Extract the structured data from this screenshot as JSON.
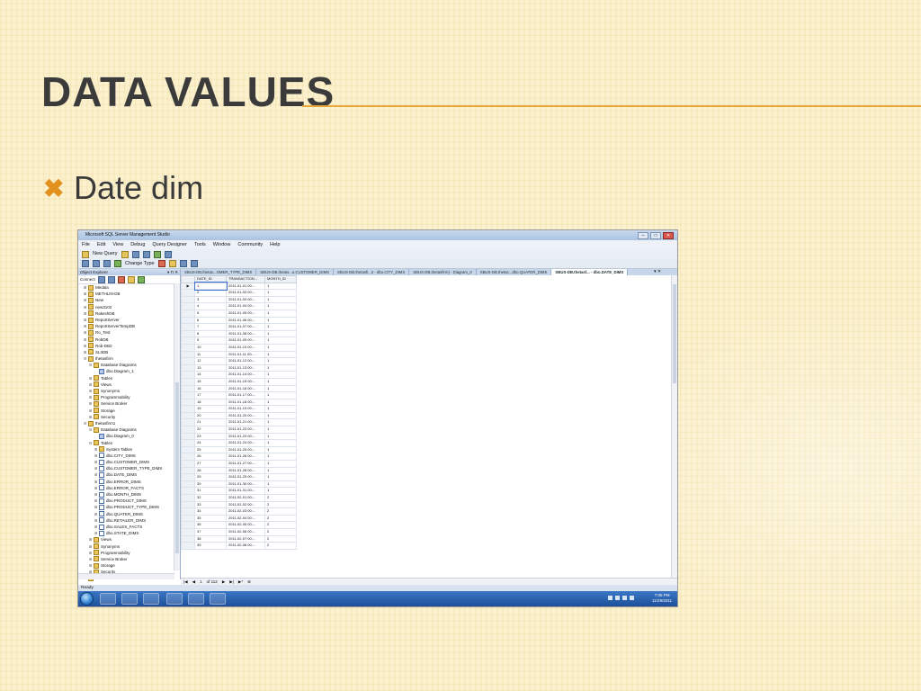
{
  "slide": {
    "title": "Data Values",
    "bullet_mark": "✖",
    "bullet": "Date dim"
  },
  "ssms": {
    "window_title": "Microsoft SQL Server Management Studio",
    "window_controls": [
      "–",
      "□",
      "✕"
    ],
    "menu": [
      "File",
      "Edit",
      "View",
      "Debug",
      "Query Designer",
      "Tools",
      "Window",
      "Community",
      "Help"
    ],
    "toolbar1": {
      "new_query": "New Query"
    },
    "toolbar2": {
      "change_type": "Change Type"
    },
    "explorer": {
      "title": "Object Explorer",
      "header_controls": "▾ ⊓ ✕",
      "connect": "Connect",
      "tree": [
        {
          "indent": 1,
          "pm": "⊞",
          "icon": "folder",
          "label": "Medala"
        },
        {
          "indent": 1,
          "pm": "⊞",
          "icon": "folder",
          "label": "METHLIN-DB"
        },
        {
          "indent": 1,
          "pm": "⊞",
          "icon": "folder",
          "label": "New"
        },
        {
          "indent": 1,
          "pm": "⊞",
          "icon": "folder",
          "label": "new3102"
        },
        {
          "indent": 1,
          "pm": "⊞",
          "icon": "folder",
          "label": "RakeshDB"
        },
        {
          "indent": 1,
          "pm": "⊞",
          "icon": "folder",
          "label": "ReportServer"
        },
        {
          "indent": 1,
          "pm": "⊞",
          "icon": "folder",
          "label": "ReportServerTempDB"
        },
        {
          "indent": 1,
          "pm": "⊞",
          "icon": "folder",
          "label": "Ro_Test"
        },
        {
          "indent": 1,
          "pm": "⊞",
          "icon": "folder",
          "label": "RobDB"
        },
        {
          "indent": 1,
          "pm": "⊞",
          "icon": "folder",
          "label": "Rob-DB2"
        },
        {
          "indent": 1,
          "pm": "⊞",
          "icon": "folder",
          "label": "SLIIDB"
        },
        {
          "indent": 1,
          "pm": "⊟",
          "icon": "folder",
          "label": "thetasfirm"
        },
        {
          "indent": 2,
          "pm": "⊟",
          "icon": "folder",
          "label": "Database Diagrams"
        },
        {
          "indent": 3,
          "pm": "",
          "icon": "diagram",
          "label": "dbo.Diagram_1"
        },
        {
          "indent": 2,
          "pm": "⊞",
          "icon": "folder",
          "label": "Tables"
        },
        {
          "indent": 2,
          "pm": "⊞",
          "icon": "folder",
          "label": "Views"
        },
        {
          "indent": 2,
          "pm": "⊞",
          "icon": "folder",
          "label": "Synonyms"
        },
        {
          "indent": 2,
          "pm": "⊞",
          "icon": "folder",
          "label": "Programmability"
        },
        {
          "indent": 2,
          "pm": "⊞",
          "icon": "folder",
          "label": "Service Broker"
        },
        {
          "indent": 2,
          "pm": "⊞",
          "icon": "folder",
          "label": "Storage"
        },
        {
          "indent": 2,
          "pm": "⊞",
          "icon": "folder",
          "label": "Security"
        },
        {
          "indent": 1,
          "pm": "⊟",
          "icon": "folder",
          "label": "thetasfirm1"
        },
        {
          "indent": 2,
          "pm": "⊟",
          "icon": "folder",
          "label": "Database Diagrams"
        },
        {
          "indent": 3,
          "pm": "",
          "icon": "diagram",
          "label": "dbo.Diagram_0"
        },
        {
          "indent": 2,
          "pm": "⊟",
          "icon": "folder",
          "label": "Tables"
        },
        {
          "indent": 3,
          "pm": "⊞",
          "icon": "folder",
          "label": "System Tables"
        },
        {
          "indent": 3,
          "pm": "⊞",
          "icon": "table",
          "label": "dbo.CITY_DIMS"
        },
        {
          "indent": 3,
          "pm": "⊞",
          "icon": "table",
          "label": "dbo.CUSTOMER_DIMS"
        },
        {
          "indent": 3,
          "pm": "⊞",
          "icon": "table",
          "label": "dbo.CUSTOMER_TYPE_DIMS"
        },
        {
          "indent": 3,
          "pm": "⊞",
          "icon": "table",
          "label": "dbo.DATE_DIMS"
        },
        {
          "indent": 3,
          "pm": "⊞",
          "icon": "table",
          "label": "dbo.ERROR_DIMS"
        },
        {
          "indent": 3,
          "pm": "⊞",
          "icon": "table",
          "label": "dbo.ERROR_FACTS"
        },
        {
          "indent": 3,
          "pm": "⊞",
          "icon": "table",
          "label": "dbo.MONTH_DIMS"
        },
        {
          "indent": 3,
          "pm": "⊞",
          "icon": "table",
          "label": "dbo.PRODUCT_DIMS"
        },
        {
          "indent": 3,
          "pm": "⊞",
          "icon": "table",
          "label": "dbo.PRODUCT_TYPE_DIMS"
        },
        {
          "indent": 3,
          "pm": "⊞",
          "icon": "table",
          "label": "dbo.QUATER_DIMS"
        },
        {
          "indent": 3,
          "pm": "⊞",
          "icon": "table",
          "label": "dbo.RETAILER_DIMS"
        },
        {
          "indent": 3,
          "pm": "⊞",
          "icon": "table",
          "label": "dbo.SALES_FACTS"
        },
        {
          "indent": 3,
          "pm": "⊞",
          "icon": "table",
          "label": "dbo.STATE_DIMS"
        },
        {
          "indent": 2,
          "pm": "⊞",
          "icon": "folder",
          "label": "Views"
        },
        {
          "indent": 2,
          "pm": "⊞",
          "icon": "folder",
          "label": "Synonyms"
        },
        {
          "indent": 2,
          "pm": "⊞",
          "icon": "folder",
          "label": "Programmability"
        },
        {
          "indent": 2,
          "pm": "⊞",
          "icon": "folder",
          "label": "Service Broker"
        },
        {
          "indent": 2,
          "pm": "⊞",
          "icon": "folder",
          "label": "Storage"
        },
        {
          "indent": 2,
          "pm": "⊞",
          "icon": "folder",
          "label": "Security"
        },
        {
          "indent": 1,
          "pm": "⊞",
          "icon": "folder",
          "label": "uthemz0992"
        }
      ]
    },
    "tabs": [
      {
        "label": "SBUS-DB.thetas...OMER_TYPE_DIMS",
        "active": false
      },
      {
        "label": "SBUS-DB.thetas...o.CUSTOMER_DIMS",
        "active": false
      },
      {
        "label": "SBUS-DB.thetasfi...2 - dbo.CITY_DIMS",
        "active": false
      },
      {
        "label": "SBUS-DB.thetasfirm) - Diagram_0",
        "active": false
      },
      {
        "label": "SBUS-DB.thetas...dbo.QUATER_DIMS",
        "active": false
      },
      {
        "label": "SBUS-DB.thetasf... - dbo.DATE_DIMS",
        "active": true
      }
    ],
    "tab_controls": "▾ ✕",
    "grid": {
      "columns": [
        "DATE_ID",
        "TRANSACTION...",
        "MONTH_ID"
      ],
      "rows": [
        [
          "1",
          "2011-01-01 00:...",
          "1"
        ],
        [
          "2",
          "2011-01-02 00:...",
          "1"
        ],
        [
          "3",
          "2011-01-03 00:...",
          "1"
        ],
        [
          "4",
          "2011-01-04 00:...",
          "1"
        ],
        [
          "5",
          "2011-01-05 00:...",
          "1"
        ],
        [
          "6",
          "2011-01-06 00:...",
          "1"
        ],
        [
          "7",
          "2011-01-07 00:...",
          "1"
        ],
        [
          "8",
          "2011-01-08 00:...",
          "1"
        ],
        [
          "9",
          "2011-01-09 00:...",
          "1"
        ],
        [
          "10",
          "2011-01-10 00:...",
          "1"
        ],
        [
          "11",
          "2011-01-11 00:...",
          "1"
        ],
        [
          "12",
          "2011-01-12 00:...",
          "1"
        ],
        [
          "13",
          "2011-01-13 00:...",
          "1"
        ],
        [
          "14",
          "2011-01-14 00:...",
          "1"
        ],
        [
          "15",
          "2011-01-15 00:...",
          "1"
        ],
        [
          "16",
          "2011-01-16 00:...",
          "1"
        ],
        [
          "17",
          "2011-01-17 00:...",
          "1"
        ],
        [
          "18",
          "2011-01-18 00:...",
          "1"
        ],
        [
          "19",
          "2011-01-19 00:...",
          "1"
        ],
        [
          "20",
          "2011-01-20 00:...",
          "1"
        ],
        [
          "21",
          "2011-01-21 00:...",
          "1"
        ],
        [
          "22",
          "2011-01-22 00:...",
          "1"
        ],
        [
          "23",
          "2011-01-23 00:...",
          "1"
        ],
        [
          "24",
          "2011-01-24 00:...",
          "1"
        ],
        [
          "25",
          "2011-01-25 00:...",
          "1"
        ],
        [
          "26",
          "2011-01-26 00:...",
          "1"
        ],
        [
          "27",
          "2011-01-27 00:...",
          "1"
        ],
        [
          "28",
          "2011-01-28 00:...",
          "1"
        ],
        [
          "29",
          "2011-01-29 00:...",
          "1"
        ],
        [
          "30",
          "2011-01-30 00:...",
          "1"
        ],
        [
          "31",
          "2011-01-31 00:...",
          "1"
        ],
        [
          "32",
          "2011-02-01 00:...",
          "2"
        ],
        [
          "33",
          "2011-02-02 00:...",
          "2"
        ],
        [
          "34",
          "2011-02-03 00:...",
          "2"
        ],
        [
          "35",
          "2011-02-04 00:...",
          "2"
        ],
        [
          "36",
          "2011-02-05 00:...",
          "2"
        ],
        [
          "37",
          "2011-02-06 00:...",
          "2"
        ],
        [
          "38",
          "2011-02-07 00:...",
          "2"
        ],
        [
          "39",
          "2011-02-08 00:...",
          "2"
        ]
      ],
      "current_row_marker": "▶"
    },
    "navigator": {
      "first": "|◀",
      "prev": "◀",
      "position": "1",
      "of": "of 112",
      "next": "▶",
      "last": "▶|",
      "new": "▶*",
      "stop": "⊗"
    },
    "status": "Ready",
    "clock": {
      "time": "7:05 PM",
      "date": "11/29/2011"
    }
  }
}
